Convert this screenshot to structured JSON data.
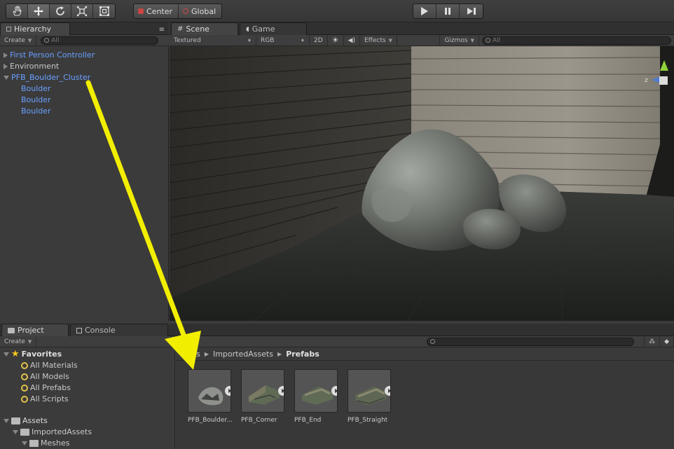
{
  "toolbar": {
    "tools": [
      {
        "name": "hand-tool"
      },
      {
        "name": "move-tool"
      },
      {
        "name": "rotate-tool"
      },
      {
        "name": "scale-tool"
      },
      {
        "name": "rect-tool"
      }
    ],
    "pivot_center": "Center",
    "pivot_global": "Global"
  },
  "hierarchy": {
    "tab": "Hierarchy",
    "create": "Create",
    "search_placeholder": "All",
    "items": [
      {
        "label": "First Person Controller"
      },
      {
        "label": "Environment"
      },
      {
        "label": "PFB_Boulder_Cluster"
      },
      {
        "label": "Boulder"
      },
      {
        "label": "Boulder"
      },
      {
        "label": "Boulder"
      }
    ]
  },
  "scene": {
    "tab_scene": "Scene",
    "tab_game": "Game",
    "draw_mode": "Textured",
    "render_mode": "RGB",
    "mode_2d": "2D",
    "effects": "Effects",
    "gizmos": "Gizmos",
    "search_placeholder": "All"
  },
  "project": {
    "tab_project": "Project",
    "tab_console": "Console",
    "create": "Create",
    "favorites_label": "Favorites",
    "favorites": [
      {
        "label": "All Materials"
      },
      {
        "label": "All Models"
      },
      {
        "label": "All Prefabs"
      },
      {
        "label": "All Scripts"
      }
    ],
    "assets_label": "Assets",
    "imported_assets": "ImportedAssets",
    "meshes": "Meshes",
    "breadcrumb": {
      "part1": "ets",
      "part2": "ImportedAssets",
      "part3": "Prefabs"
    },
    "assets": [
      {
        "label": "PFB_Boulder..."
      },
      {
        "label": "PFB_Corner"
      },
      {
        "label": "PFB_End"
      },
      {
        "label": "PFB_Straight"
      }
    ]
  },
  "colors": {
    "selection_blue": "#6aa0ff",
    "annotation_arrow": "#f2ee00"
  }
}
